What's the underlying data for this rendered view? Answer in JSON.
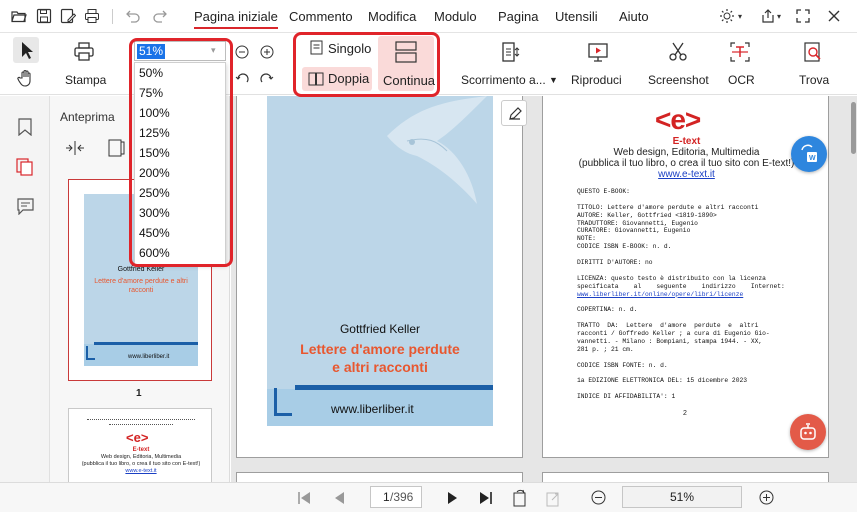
{
  "menu": {
    "tabs": [
      "Pagina iniziale",
      "Commento",
      "Modifica",
      "Modulo",
      "Pagina",
      "Utensili",
      "Aiuto"
    ]
  },
  "ribbon": {
    "print_label": "Stampa",
    "zoom_value": "51%",
    "single_label": "Singolo",
    "double_label": "Doppia",
    "continuous_label": "Continua",
    "scroll_label": "Scorrimento a...",
    "play_label": "Riproduci",
    "screenshot_label": "Screenshot",
    "ocr_label": "OCR",
    "find_label": "Trova"
  },
  "zoom_options": [
    "50%",
    "75%",
    "100%",
    "125%",
    "150%",
    "200%",
    "250%",
    "300%",
    "450%",
    "600%"
  ],
  "thumbnails": {
    "title": "Anteprima",
    "page1_number": "1",
    "page1_author": "Gottfried Keller",
    "page1_title": "Lettere d'amore perdute e altri racconti",
    "page1_site": "www.liberliber.it",
    "page2_brand": "E-text",
    "page2_line1": "Web design, Editoria, Multimedia",
    "page2_line2": "(pubblica il tuo libro, o crea il tuo sito con E-text!)",
    "page2_url": "www.e-text.it"
  },
  "cover": {
    "author": "Gottfried Keller",
    "title_line1": "Lettere d'amore perdute",
    "title_line2": "e altri racconti",
    "site": "www.liberliber.it"
  },
  "page2": {
    "logo_text": "e",
    "brand": "E-text",
    "line1": "Web design, Editoria, Multimedia",
    "line2": "(pubblica il tuo libro, o crea il tuo sito con E-text!)",
    "url": "www.e-text.it",
    "body": [
      "QUESTO E-BOOK:",
      "",
      "TITOLO: Lettere d'amore perdute e altri racconti",
      "AUTORE: Keller, Gottfried <1819-1890>",
      "TRADUTTORE: Giovannetti, Eugenio",
      "CURATORE: Giovannetti, Eugenio",
      "NOTE:",
      "CODICE ISBN E-BOOK: n. d.",
      "",
      "DIRITTI D'AUTORE: no",
      "",
      "LICENZA: questo testo è distribuito con la licenza",
      "specificata    al    seguente    indirizzo    Internet:",
      "www.liberliber.it/online/opere/libri/licenze",
      "",
      "COPERTINA: n. d.",
      "",
      "TRATTO  DA:  Lettere  d'amore  perdute  e  altri",
      "racconti / Goffredo Keller ; a cura di Eugenio Gio-",
      "vannetti. - Milano : Bompiani, stampa 1944. - XX,",
      "281 p. ; 21 cm.",
      "",
      "CODICE ISBN FONTE: n. d.",
      "",
      "1a EDIZIONE ELETTRONICA DEL: 15 dicembre 2023",
      "",
      "INDICE DI AFFIDABILITA': 1"
    ],
    "page_number": "2"
  },
  "status": {
    "page_input": "1",
    "page_total": "/396",
    "zoom": "51%"
  },
  "colors": {
    "accent": "#d9262b",
    "cover_blue": "#bcd6e8",
    "cover_orange": "#e8572f",
    "etext_red": "#d32323"
  }
}
